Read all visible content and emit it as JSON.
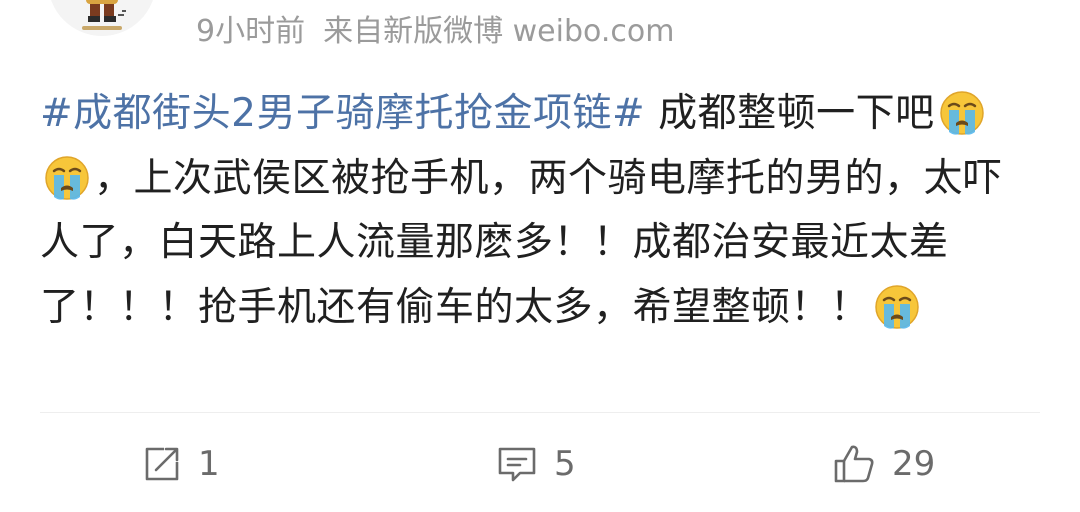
{
  "post": {
    "meta": {
      "time": "9小时前",
      "source": "来自新版微博 weibo.com"
    },
    "content": {
      "hashtag": "#成都街头2男子骑摩托抢金项链#",
      "text_1": " 成都整顿一下吧",
      "text_2": "，上次武侯区被抢手机，两个骑电摩托的男的，太吓人了，白天路上人流量那麽多！！成都治安最近太差了！！！抢手机还有偷车的太多，希望整顿！！",
      "emoji_name": "crying-face"
    },
    "actions": {
      "share_count": "1",
      "comment_count": "5",
      "like_count": "29"
    }
  },
  "icons": {
    "share": "share-icon",
    "comment": "comment-icon",
    "like": "thumbs-up-icon"
  },
  "colors": {
    "hashtag": "#4d72a6",
    "text": "#202020",
    "meta": "#9b9b9b",
    "action": "#6b6b6b"
  }
}
